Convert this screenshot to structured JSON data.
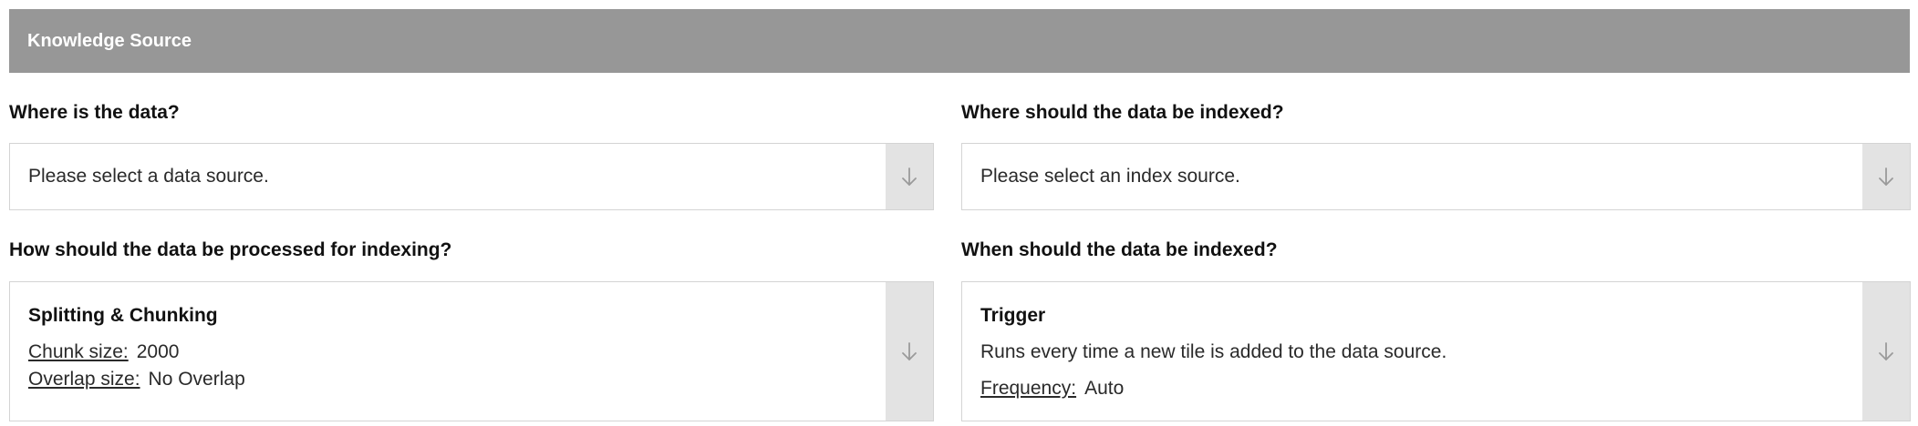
{
  "header": {
    "title": "Knowledge Source"
  },
  "data_source": {
    "question": "Where is the data?",
    "placeholder": "Please select a data source."
  },
  "index_source": {
    "question": "Where should the data be indexed?",
    "placeholder": "Please select an index source."
  },
  "processing": {
    "question": "How should the data be processed for indexing?",
    "title": "Splitting & Chunking",
    "chunk_size_label": "Chunk size:",
    "chunk_size_value": "2000",
    "overlap_size_label": "Overlap size:",
    "overlap_size_value": "No Overlap"
  },
  "schedule": {
    "question": "When should the data be indexed?",
    "title": "Trigger",
    "description": "Runs every time a new tile is added to the data source.",
    "frequency_label": "Frequency:",
    "frequency_value": "Auto"
  },
  "icons": {
    "dropdown": "arrow-down-icon"
  }
}
